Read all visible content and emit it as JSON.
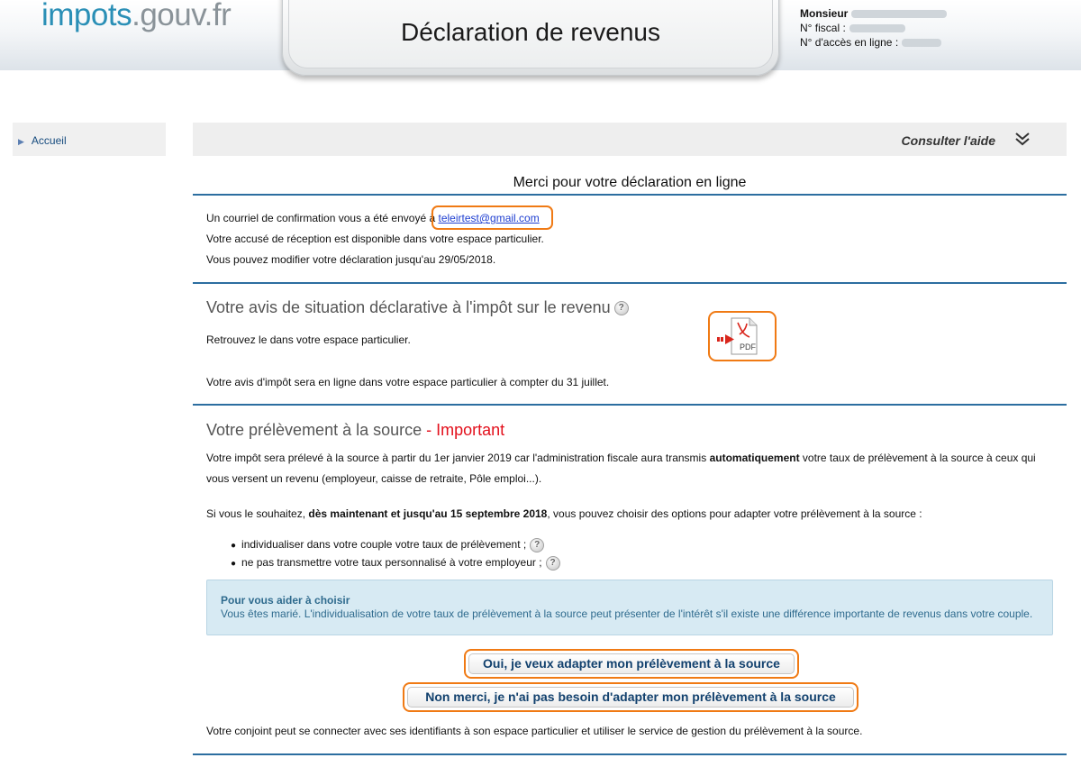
{
  "header": {
    "logo_part1": "impots",
    "logo_part2": ".gouv.fr",
    "page_title": "Déclaration de revenus",
    "user_label": "Monsieur",
    "fiscal_label": "N° fiscal :",
    "access_label": "N° d'accès en ligne :"
  },
  "sidebar": {
    "items": [
      {
        "label": "Accueil"
      }
    ]
  },
  "helpbar": {
    "label": "Consulter l'aide",
    "icon": "double-chevron-down-icon"
  },
  "confirmation": {
    "title": "Merci pour votre déclaration en ligne",
    "line1_prefix": "Un courriel de confirmation vous a été envoyé à",
    "email": "teleirtest@gmail.com",
    "line2": "Votre accusé de réception est disponible dans votre espace particulier.",
    "line3": "Vous pouvez modifier votre déclaration jusqu'au 29/05/2018."
  },
  "avis": {
    "title": "Votre avis de situation déclarative à l'impôt sur le revenu",
    "text1": "Retrouvez le dans votre espace particulier.",
    "pdf_label": "PDF",
    "text2": "Votre avis d'impôt sera en ligne dans votre espace particulier à compter du 31 juillet."
  },
  "prelevement": {
    "title": "Votre prélèvement à la source",
    "title_important": " - Important",
    "p1_a": "Votre impôt sera prélevé à la source à partir du 1er janvier 2019 car l'administration fiscale aura transmis ",
    "p1_bold": "automatiquement",
    "p1_b": " votre taux de prélèvement à la source à ceux qui vous versent un revenu (employeur, caisse de retraite, Pôle emploi...).",
    "p2_a": "Si vous le souhaitez, ",
    "p2_bold": "dès maintenant et jusqu'au 15 septembre 2018",
    "p2_b": ", vous pouvez choisir des options pour adapter votre prélèvement à la source :",
    "bullets": [
      "individualiser dans votre couple votre taux de prélèvement ;",
      "ne pas transmettre votre taux personnalisé à votre employeur ;"
    ],
    "info_title": "Pour vous aider à choisir",
    "info_text": "Vous êtes marié. L'individualisation de votre taux de prélèvement à la source peut présenter de l'intérêt s'il existe une différence importante de revenus dans votre couple.",
    "btn_yes": "Oui, je veux adapter mon prélèvement à la source",
    "btn_no": "Non merci, je n'ai pas besoin d'adapter mon prélèvement à la source",
    "footer_text": "Votre conjoint peut se connecter avec ses identifiants à son espace particulier et utiliser le service de gestion du prélèvement à la source."
  },
  "colors": {
    "accent_blue": "#2c6ea0",
    "highlight_orange": "#f07a14",
    "important_red": "#e3101c",
    "info_bg": "#d7eaf3"
  }
}
